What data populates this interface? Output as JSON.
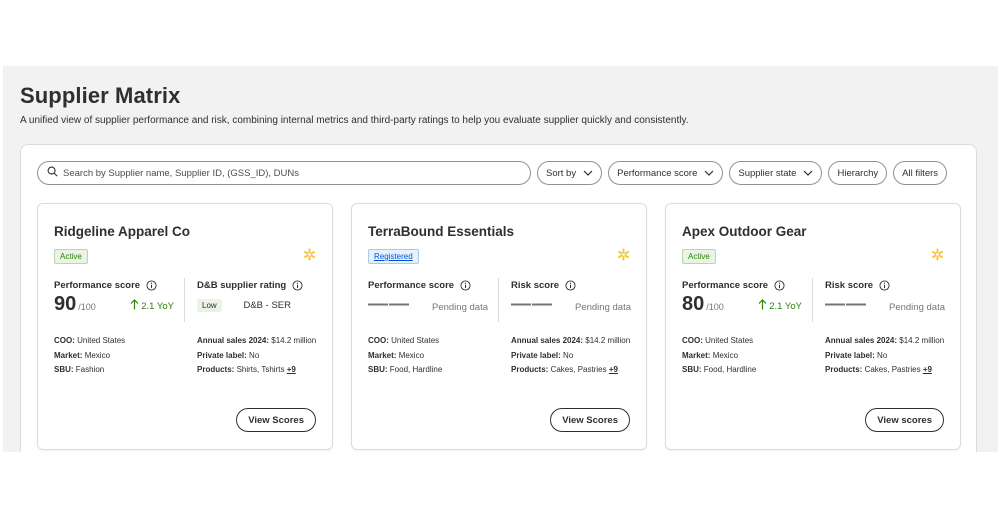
{
  "header": {
    "title": "Supplier Matrix",
    "subtitle": "A unified view of supplier performance and risk, combining internal metrics and third-party ratings to help you evaluate supplier quickly and consistently."
  },
  "toolbar": {
    "search_placeholder": "Search by Supplier name, Supplier ID, (GSS_ID), DUNs",
    "sort_label": "Sort by",
    "performance_label": "Performance score",
    "state_label": "Supplier state",
    "hierarchy_label": "Hierarchy",
    "all_filters_label": "All filters"
  },
  "colors": {
    "accent_green": "#2a8703",
    "accent_blue": "#0053e2",
    "spark_yellow": "#ffc220"
  },
  "cards": [
    {
      "name": "Ridgeline Apparel Co",
      "status": "Active",
      "perf_label": "Performance score",
      "perf_value": "90",
      "perf_denom": "/100",
      "perf_yoy": "2.1 YoY",
      "second_label": "D&B supplier rating",
      "dnb_risk": "Low",
      "dnb_value": "D&B - SER",
      "coo_label": "COO:",
      "coo": "United States",
      "market_label": "Market:",
      "market": "Mexico",
      "sbu_label": "SBU:",
      "sbu": "Fashion",
      "sales_label": "Annual sales 2024:",
      "sales": "$14.2 million",
      "private_label_label": "Private label:",
      "private_label": "No",
      "products_label": "Products:",
      "products": "Shirts, Tshirts",
      "products_more": "+9",
      "button": "View Scores"
    },
    {
      "name": "TerraBound Essentials",
      "status": "Registered",
      "perf_label": "Performance score",
      "perf_dash": "——",
      "perf_pending": "Pending data",
      "second_label": "Risk score",
      "risk_dash": "——",
      "risk_pending": "Pending data",
      "coo_label": "COO:",
      "coo": "United States",
      "market_label": "Market:",
      "market": "Mexico",
      "sbu_label": "SBU:",
      "sbu": "Food, Hardline",
      "sales_label": "Annual sales 2024:",
      "sales": "$14.2 million",
      "private_label_label": "Private label:",
      "private_label": "No",
      "products_label": "Products:",
      "products": "Cakes, Pastries",
      "products_more": "+9",
      "button": "View Scores"
    },
    {
      "name": "Apex Outdoor Gear",
      "status": "Active",
      "perf_label": "Performance score",
      "perf_value": "80",
      "perf_denom": "/100",
      "perf_yoy": "2.1 YoY",
      "second_label": "Risk score",
      "risk_dash": "——",
      "risk_pending": "Pending data",
      "coo_label": "COO:",
      "coo": "United States",
      "market_label": "Market:",
      "market": "Mexico",
      "sbu_label": "SBU:",
      "sbu": "Food, Hardline",
      "sales_label": "Annual sales 2024:",
      "sales": "$14.2 million",
      "private_label_label": "Private label:",
      "private_label": "No",
      "products_label": "Products:",
      "products": "Cakes, Pastries",
      "products_more": "+9",
      "button": "View scores"
    }
  ]
}
